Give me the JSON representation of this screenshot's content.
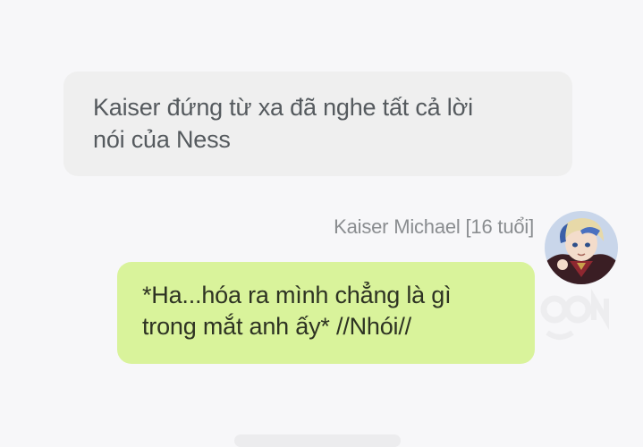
{
  "conversation": {
    "narration": {
      "text": "Kaiser đứng từ xa đã nghe tất cả lời\nnói của Ness"
    },
    "message": {
      "sender": "Kaiser Michael [16 tuổi]",
      "avatar_icon": "character-avatar",
      "text": "*Ha...hóa ra mình chẳng là gì\ntrong mắt anh ấy* //Nhói//"
    }
  },
  "colors": {
    "background": "#f7f7f9",
    "narration_bubble": "#efefef",
    "message_bubble": "#d9f39b",
    "sender_name": "#8a8d90"
  }
}
